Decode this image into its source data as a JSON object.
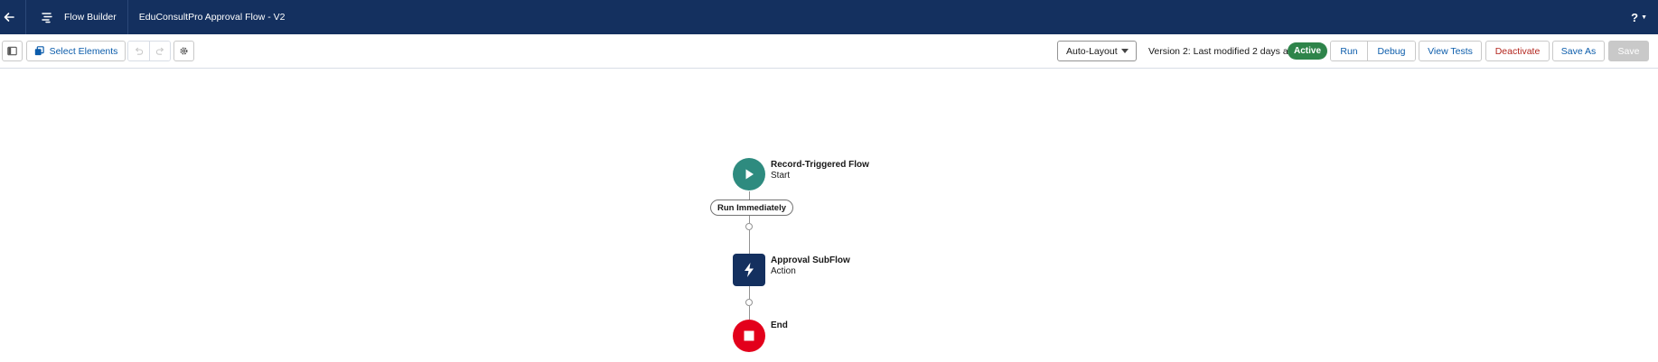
{
  "header": {
    "app_label": "Flow Builder",
    "flow_title": "EduConsultPro Approval Flow - V2",
    "help_label": "?"
  },
  "toolbar": {
    "select_elements_label": "Select Elements",
    "layout_select": {
      "selected": "Auto-Layout"
    },
    "version_text": "Version 2: Last modified 2 days ago",
    "status_badge": "Active",
    "run_label": "Run",
    "debug_label": "Debug",
    "view_tests_label": "View Tests",
    "deactivate_label": "Deactivate",
    "save_as_label": "Save As",
    "save_label": "Save"
  },
  "canvas": {
    "start": {
      "title": "Record-Triggered Flow",
      "subtitle": "Start",
      "color": "#2e8b7f"
    },
    "path_label": "Run Immediately",
    "action": {
      "title": "Approval SubFlow",
      "subtitle": "Action",
      "color": "#14305f"
    },
    "end": {
      "title": "End",
      "color": "#e3001b"
    }
  },
  "colors": {
    "header_bg": "#14305f",
    "link_blue": "#0b5cab",
    "active_green": "#2e844a",
    "destructive_red": "#b3261e"
  },
  "icons": [
    "back-arrow-icon",
    "flow-icon",
    "help-icon",
    "toggle-panel-icon",
    "select-elements-icon",
    "undo-icon",
    "redo-icon",
    "settings-gear-icon",
    "play-icon",
    "lightning-bolt-icon",
    "stop-icon"
  ]
}
